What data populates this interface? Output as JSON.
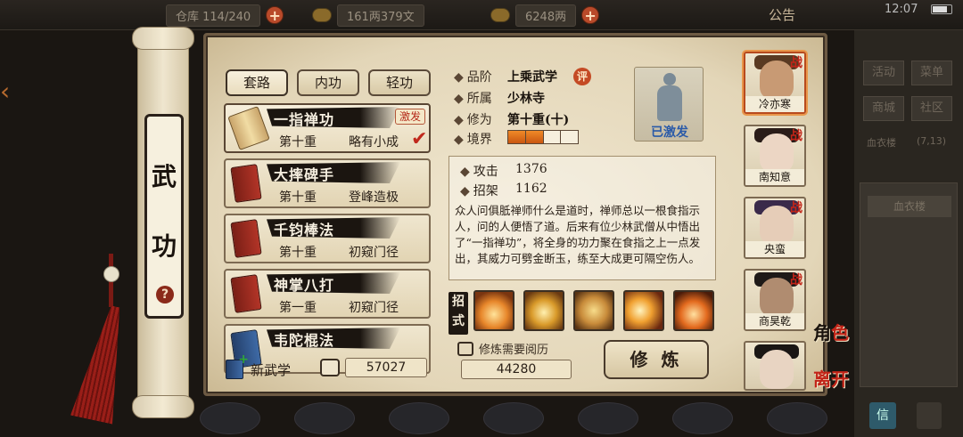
{
  "topbar": {
    "storage": "仓库 114/240",
    "copper": "161两379文",
    "silver": "6248两",
    "notice": "公告",
    "clock": "12:07"
  },
  "right_panel": {
    "buttons": [
      "活动",
      "菜单",
      "商城",
      "社区"
    ],
    "sect": "血衣楼",
    "sect_coord": "(7,13)",
    "field": "血衣楼",
    "foot_btn": "信"
  },
  "scroll": {
    "title_1": "武",
    "title_2": "功",
    "help": "?"
  },
  "tabs": [
    "套路",
    "内功",
    "轻功"
  ],
  "skills": [
    {
      "name": "一指禅功",
      "level": "第十重",
      "progress": "略有小成",
      "badge": "激发",
      "book": "open"
    },
    {
      "name": "大摔碑手",
      "level": "第十重",
      "progress": "登峰造极",
      "badge": "",
      "book": "red"
    },
    {
      "name": "千钧棒法",
      "level": "第十重",
      "progress": "初窥门径",
      "badge": "",
      "book": "red"
    },
    {
      "name": "神掌八打",
      "level": "第一重",
      "progress": "初窥门径",
      "badge": "",
      "book": "red"
    },
    {
      "name": "韦陀棍法",
      "level": "",
      "progress": "",
      "badge": "",
      "book": "blue"
    }
  ],
  "footer_left": {
    "new_skill": "新武学",
    "scroll_count": "57027"
  },
  "info": {
    "grade_label": "品阶",
    "grade": "上乘武学",
    "grade_badge": "评",
    "school_label": "所属",
    "school": "少林寺",
    "cult_label": "修为",
    "cult": "第十重(十)",
    "realm_label": "境界",
    "realm_filled": 2,
    "realm_total": 4,
    "portrait_label": "已激发",
    "attack_label": "攻击",
    "attack": "1376",
    "parry_label": "招架",
    "parry": "1162",
    "description": "众人问俱胝禅师什么是道时，禅师总以一根食指示人，问的人便悟了道。后来有位少林武僧从中悟出了“一指禅功”，将全身的功力聚在食指之上一点发出，其威力可劈金断玉，练至大成更可隔空伤人。"
  },
  "moves": {
    "label": "招式",
    "icons": [
      "flame-palm-icon",
      "golden-bell-icon",
      "meditating-monk-icon",
      "fire-finger-icon",
      "fire-burst-icon"
    ]
  },
  "cultivate": {
    "requirement": "修炼需要阅历",
    "amount": "44280",
    "button": "修 炼"
  },
  "characters": [
    {
      "name": "冷亦寒",
      "war": "战",
      "selected": true
    },
    {
      "name": "南知意",
      "war": "战",
      "selected": false
    },
    {
      "name": "央蛮",
      "war": "战",
      "selected": false
    },
    {
      "name": "商昊乾",
      "war": "战",
      "selected": false
    },
    {
      "name": "",
      "war": "",
      "selected": false
    }
  ],
  "side_calls": {
    "role_1": "角",
    "role_2": "色",
    "leave_1": "离",
    "leave_2": "开"
  }
}
